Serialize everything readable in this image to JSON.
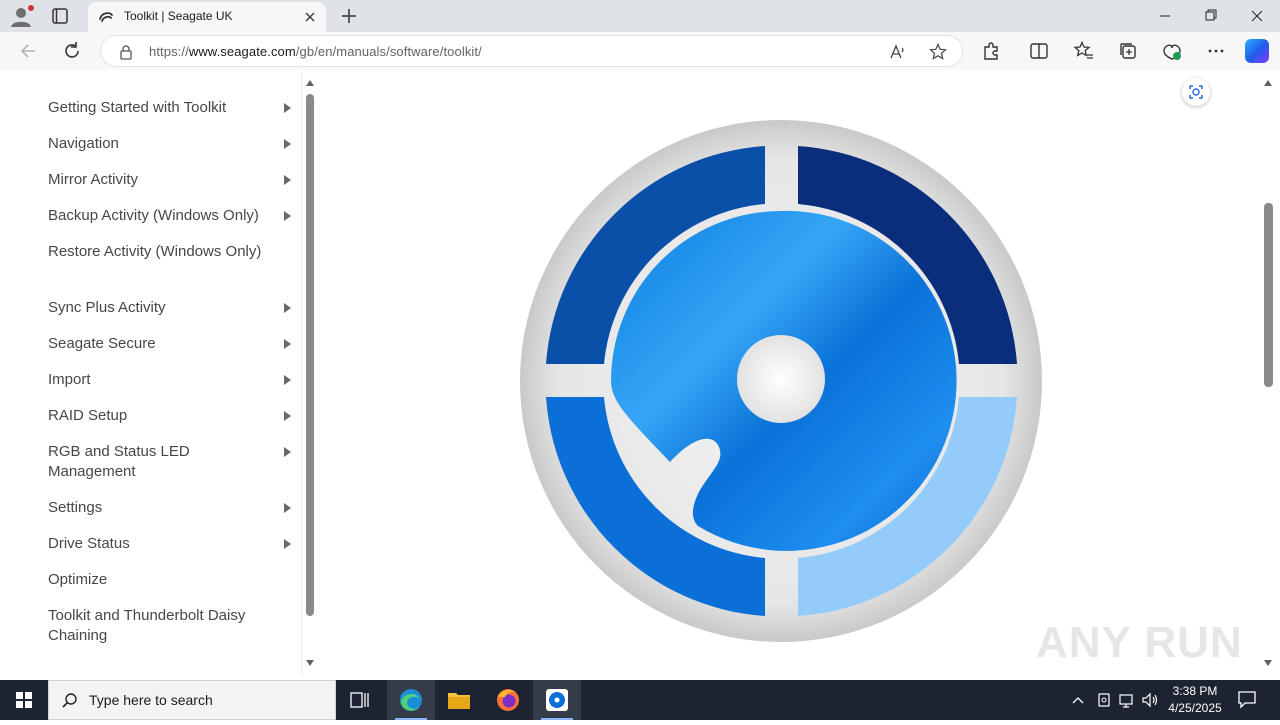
{
  "browser": {
    "tab_title": "Toolkit | Seagate UK",
    "url_prefix": "https://",
    "url_host": "www.seagate.com",
    "url_path": "/gb/en/manuals/software/toolkit/"
  },
  "sidebar": {
    "items": [
      {
        "label": "Getting Started with Toolkit",
        "has_arrow": true
      },
      {
        "label": "Navigation",
        "has_arrow": true
      },
      {
        "label": "Mirror Activity",
        "has_arrow": true
      },
      {
        "label": "Backup Activity (Windows Only)",
        "has_arrow": true
      },
      {
        "label": "Restore Activity (Windows Only)",
        "has_arrow": false
      },
      {
        "label": "Sync Plus Activity",
        "has_arrow": true
      },
      {
        "label": "Seagate Secure",
        "has_arrow": true
      },
      {
        "label": "Import",
        "has_arrow": true
      },
      {
        "label": "RAID Setup",
        "has_arrow": true
      },
      {
        "label": "RGB and Status LED Management",
        "has_arrow": true
      },
      {
        "label": "Settings",
        "has_arrow": true
      },
      {
        "label": "Drive Status",
        "has_arrow": true
      },
      {
        "label": "Optimize",
        "has_arrow": false
      },
      {
        "label": "Toolkit and Thunderbolt Daisy Chaining",
        "has_arrow": false
      }
    ]
  },
  "watermark": {
    "text": "ANY RUN"
  },
  "taskbar": {
    "search_placeholder": "Type here to search",
    "time": "3:38 PM",
    "date": "4/25/2025"
  },
  "colors": {
    "toolkit_dark_blue": "#0a2d7c",
    "toolkit_mid_blue": "#0a6fd6",
    "toolkit_light_blue": "#93ccfb",
    "taskbar": "#1c2331"
  }
}
